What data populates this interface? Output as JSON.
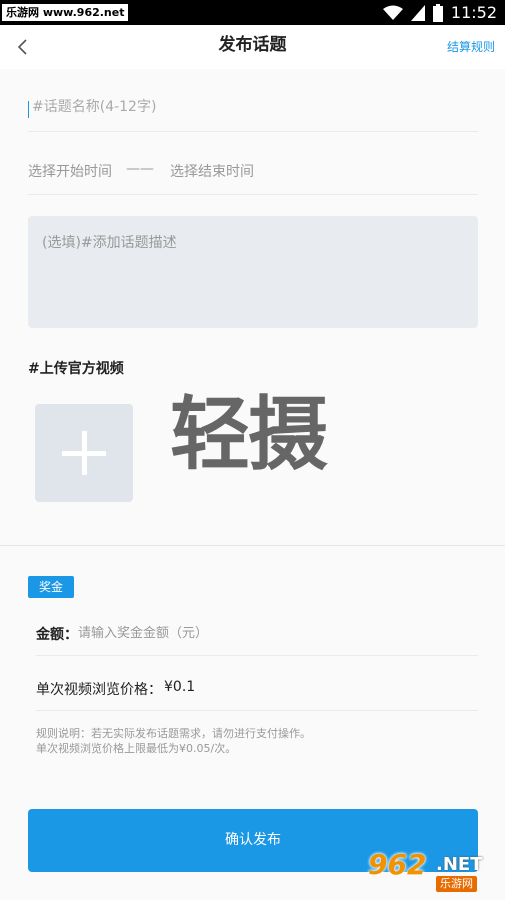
{
  "status_bar": {
    "watermark": "乐游网 www.962.net",
    "time": "11:52"
  },
  "header": {
    "title": "发布话题",
    "rules_link": "结算规则"
  },
  "form": {
    "name_placeholder": "#话题名称(4-12字)",
    "start_time_label": "选择开始时间",
    "time_separator": "——",
    "end_time_label": "选择结束时间",
    "description_placeholder": "(选填)#添加话题描述",
    "upload_label": "#上传官方视频",
    "app_logo_text": "轻摄"
  },
  "bonus": {
    "tag": "奖金",
    "amount_label": "金额：",
    "amount_placeholder": "请输入奖金金额（元）",
    "price_label": "单次视频浏览价格：",
    "price_value": "¥0.1",
    "note_line1": "规则说明：若无实际发布话题需求，请勿进行支付操作。",
    "note_line2": "单次视频浏览价格上限最低为¥0.05/次。"
  },
  "confirm_button": "确认发布",
  "watermark_logo": {
    "number": "962",
    "suffix": ".NET",
    "cn": "乐游网"
  },
  "colors": {
    "accent": "#1a98e6",
    "background": "#fafafa",
    "upload_tile": "#dfe5eb"
  }
}
